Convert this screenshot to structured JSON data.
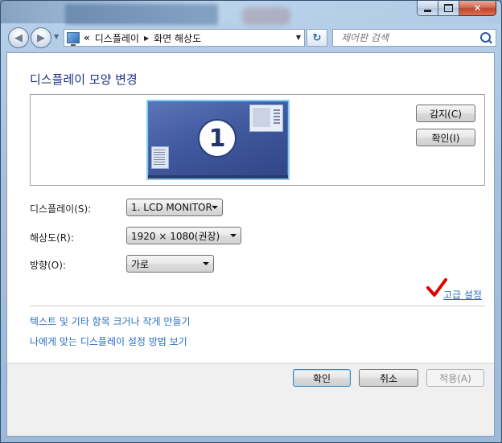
{
  "window": {
    "controls": {
      "minimize_icon": "minimize-icon",
      "maximize_icon": "maximize-icon",
      "close_icon": "close-icon"
    }
  },
  "nav": {
    "back_icon": "back-arrow-icon",
    "forward_icon": "forward-arrow-icon",
    "breadcrumb_prefix": "«",
    "breadcrumbs": [
      "디스플레이",
      "화면 해상도"
    ],
    "search_placeholder": "제어판 검색"
  },
  "page": {
    "title": "디스플레이 모양 변경",
    "monitor_number": "1",
    "detect_label": "감지(C)",
    "identify_label": "확인(I)",
    "display_label": "디스플레이(S):",
    "display_value": "1. LCD MONITOR",
    "resolution_label": "해상도(R):",
    "resolution_value": "1920 × 1080(권장)",
    "orientation_label": "방향(O):",
    "orientation_value": "가로",
    "advanced_link": "고급 설정",
    "link_text_size": "텍스트 및 기타 항목 크거나 작게 만들기",
    "link_help": "나에게 맞는 디스플레이 설정 방법 보기"
  },
  "footer": {
    "ok_label": "확인",
    "cancel_label": "취소",
    "apply_label": "적용(A)"
  },
  "colors": {
    "link": "#2a6fbf",
    "heading": "#1e3287",
    "annotation_check": "#e00000"
  }
}
